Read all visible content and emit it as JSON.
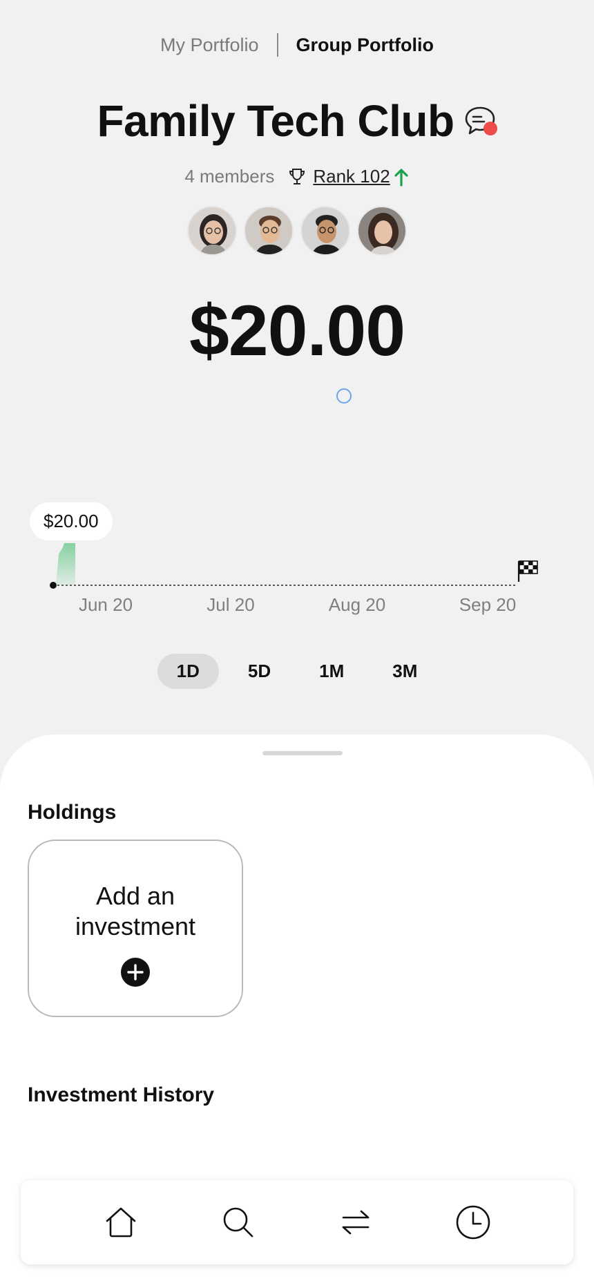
{
  "header": {
    "tabs": [
      {
        "label": "My Portfolio",
        "active": false
      },
      {
        "label": "Group Portfolio",
        "active": true
      }
    ]
  },
  "group": {
    "name": "Family Tech Club",
    "members": "4 members",
    "rank": "Rank 102",
    "rank_trend": "up",
    "avatars": [
      "member-1",
      "member-2",
      "member-3",
      "member-4"
    ]
  },
  "portfolio": {
    "value": "$20.00"
  },
  "chart_data": {
    "type": "line",
    "tooltip_value": "$20.00",
    "x_ticks": [
      "Jun 20",
      "Jul 20",
      "Aug 20",
      "Sep 20"
    ],
    "series": [
      {
        "values": [
          20,
          20
        ]
      }
    ],
    "goal_marker": "checkered-flag"
  },
  "ranges": {
    "items": [
      "1D",
      "5D",
      "1M",
      "3M"
    ],
    "selected": "1D"
  },
  "holdings": {
    "title": "Holdings",
    "add_label": "Add an investment"
  },
  "history": {
    "title": "Investment History"
  },
  "nav": {
    "items": [
      "home-icon",
      "search-icon",
      "transfer-icon",
      "history-icon"
    ]
  },
  "colors": {
    "background": "#f1f1f1",
    "notification": "#ee4b4b",
    "trend_up": "#1aa34a",
    "chart_fill": "#7fcf9c"
  }
}
